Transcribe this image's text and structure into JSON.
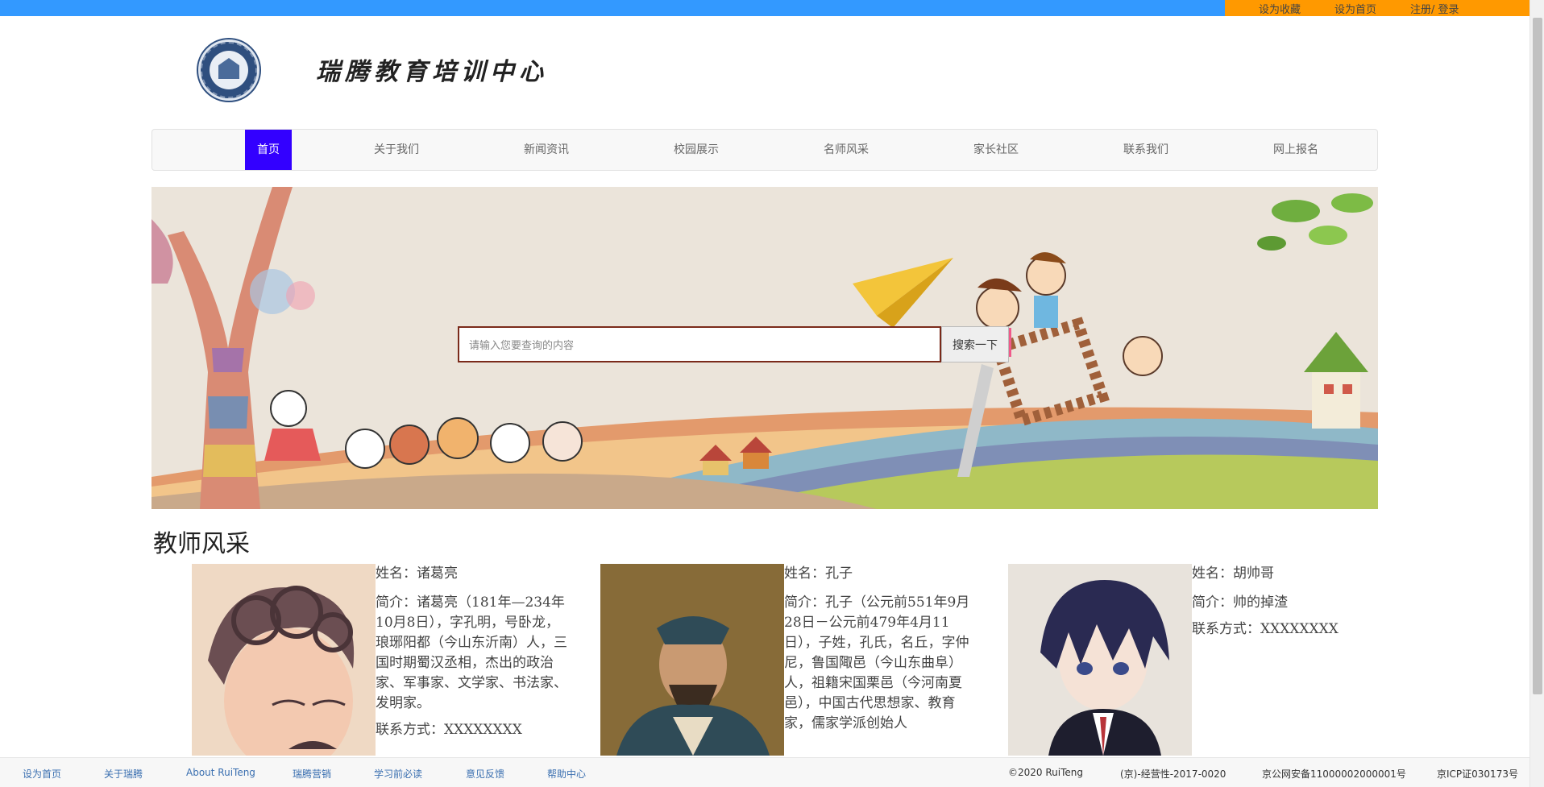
{
  "topbar": {
    "links": [
      "设为收藏",
      "设为首页",
      "注册/ 登录"
    ]
  },
  "header": {
    "title": "瑞腾教育培训中心"
  },
  "nav": {
    "items": [
      "首页",
      "关于我们",
      "新闻资讯",
      "校园展示",
      "名师风采",
      "家长社区",
      "联系我们",
      "网上报名"
    ],
    "active_index": 0
  },
  "search": {
    "placeholder": "请输入您要查询的内容",
    "button_label": "搜索一下"
  },
  "teachers_section": {
    "title": "教师风采",
    "teachers": [
      {
        "name": "姓名：诸葛亮",
        "bio": "简介：诸葛亮（181年—234年10月8日），字孔明，号卧龙，琅琊阳都（今山东沂南）人，三国时期蜀汉丞相，杰出的政治家、军事家、文学家、书法家、发明家。",
        "contact": "联系方式：XXXXXXXX"
      },
      {
        "name": "姓名：孔子",
        "bio": "简介：孔子（公元前551年9月28日－公元前479年4月11日），子姓，孔氏，名丘，字仲尼，鲁国陬邑（今山东曲阜）人，祖籍宋国栗邑（今河南夏邑），中国古代思想家、教育家，儒家学派创始人",
        "contact": ""
      },
      {
        "name": "姓名：胡帅哥",
        "bio": "简介：帅的掉渣",
        "contact": "联系方式：XXXXXXXX"
      }
    ]
  },
  "footer": {
    "links": [
      "设为首页",
      "关于瑞腾",
      "About RuiTeng",
      "瑞腾营销",
      "学习前必读",
      "意见反馈",
      "帮助中心"
    ],
    "copyright": "©2020 RuiTeng",
    "license": "(京)-经营性-2017-0020",
    "police_record": "京公网安备11000002000001号",
    "icp": "京ICP证030173号"
  },
  "colors": {
    "topbar_blue": "#3399ff",
    "topbar_orange": "#ff9900",
    "nav_active": "#3300ff"
  }
}
